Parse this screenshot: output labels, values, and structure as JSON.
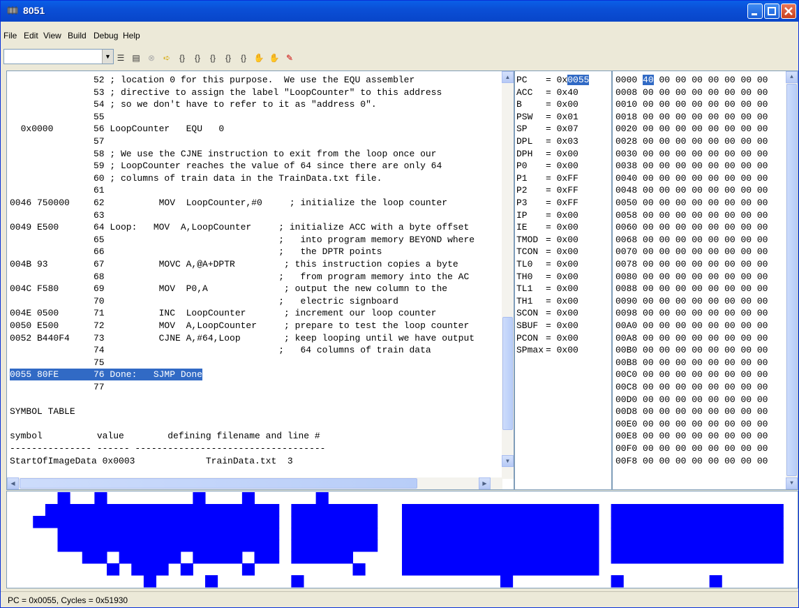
{
  "window": {
    "title": "8051"
  },
  "menu": [
    "File",
    "Edit",
    "View",
    "Build",
    "Debug",
    "Help"
  ],
  "toolbar": {
    "combo_value": "",
    "icons": [
      "list-icon",
      "step-icon",
      "stop-icon",
      "arrow-icon",
      "step-into-icon",
      "step-over-icon",
      "step-out-icon",
      "run-to-icon",
      "braces-icon",
      "hand-icon",
      "breakpoint-icon",
      "clear-icon"
    ]
  },
  "code": [
    {
      "addr": "",
      "src": "52 ; location 0 for this purpose.  We use the EQU assembler"
    },
    {
      "addr": "",
      "src": "53 ; directive to assign the label \"LoopCounter\" to this address"
    },
    {
      "addr": "",
      "src": "54 ; so we don't have to refer to it as \"address 0\"."
    },
    {
      "addr": "",
      "src": "55"
    },
    {
      "addr": "  0x0000",
      "src": "56 LoopCounter   EQU   0"
    },
    {
      "addr": "",
      "src": "57"
    },
    {
      "addr": "",
      "src": "58 ; We use the CJNE instruction to exit from the loop once our"
    },
    {
      "addr": "",
      "src": "59 ; LoopCounter reaches the value of 64 since there are only 64"
    },
    {
      "addr": "",
      "src": "60 ; columns of train data in the TrainData.txt file."
    },
    {
      "addr": "",
      "src": "61"
    },
    {
      "addr": "0046 750000",
      "src": "62          MOV  LoopCounter,#0     ; initialize the loop counter"
    },
    {
      "addr": "",
      "src": "63"
    },
    {
      "addr": "0049 E500",
      "src": "64 Loop:   MOV  A,LoopCounter     ; initialize ACC with a byte offset"
    },
    {
      "addr": "",
      "src": "65                                ;   into program memory BEYOND where"
    },
    {
      "addr": "",
      "src": "66                                ;   the DPTR points"
    },
    {
      "addr": "004B 93",
      "src": "67          MOVC A,@A+DPTR         ; this instruction copies a byte"
    },
    {
      "addr": "",
      "src": "68                                ;   from program memory into the AC"
    },
    {
      "addr": "004C F580",
      "src": "69          MOV  P0,A              ; output the new column to the"
    },
    {
      "addr": "",
      "src": "70                                ;   electric signboard"
    },
    {
      "addr": "004E 0500",
      "src": "71          INC  LoopCounter       ; increment our loop counter"
    },
    {
      "addr": "0050 E500",
      "src": "72          MOV  A,LoopCounter     ; prepare to test the loop counter"
    },
    {
      "addr": "0052 B440F4",
      "src": "73          CJNE A,#64,Loop        ; keep looping until we have output"
    },
    {
      "addr": "",
      "src": "74                                ;   64 columns of train data"
    },
    {
      "addr": "",
      "src": "75"
    },
    {
      "addr": "0055 80FE",
      "src": "76 Done:   SJMP Done",
      "highlight": true
    },
    {
      "addr": "",
      "src": "77"
    },
    {
      "addr": "",
      "src": ""
    },
    {
      "addr": "SYMBOL TABLE",
      "src": ""
    },
    {
      "addr": "",
      "src": ""
    },
    {
      "addr": "symbol          value        defining filename and line #",
      "src": ""
    },
    {
      "addr": "--------------- ------ -----------------------------------",
      "src": ""
    },
    {
      "addr": "StartOfImageData 0x0003             TrainData.txt  3",
      "src": ""
    }
  ],
  "registers": [
    {
      "name": "PC",
      "prefix": "= 0x",
      "value": "0055",
      "highlight": true
    },
    {
      "name": "ACC",
      "prefix": "= 0x",
      "value": "40"
    },
    {
      "name": "B",
      "prefix": "= 0x",
      "value": "00"
    },
    {
      "name": "PSW",
      "prefix": "= 0x",
      "value": "01"
    },
    {
      "name": "SP",
      "prefix": "= 0x",
      "value": "07"
    },
    {
      "name": "DPL",
      "prefix": "= 0x",
      "value": "03"
    },
    {
      "name": "DPH",
      "prefix": "= 0x",
      "value": "00"
    },
    {
      "name": "P0",
      "prefix": "= 0x",
      "value": "00"
    },
    {
      "name": "P1",
      "prefix": "= 0x",
      "value": "FF"
    },
    {
      "name": "P2",
      "prefix": "= 0x",
      "value": "FF"
    },
    {
      "name": "P3",
      "prefix": "= 0x",
      "value": "FF"
    },
    {
      "name": "IP",
      "prefix": "= 0x",
      "value": "00"
    },
    {
      "name": "IE",
      "prefix": "= 0x",
      "value": "00"
    },
    {
      "name": "TMOD",
      "prefix": "= 0x",
      "value": "00"
    },
    {
      "name": "TCON",
      "prefix": "= 0x",
      "value": "00"
    },
    {
      "name": "TL0",
      "prefix": "= 0x",
      "value": "00"
    },
    {
      "name": "TH0",
      "prefix": "= 0x",
      "value": "00"
    },
    {
      "name": "TL1",
      "prefix": "= 0x",
      "value": "00"
    },
    {
      "name": "TH1",
      "prefix": "= 0x",
      "value": "00"
    },
    {
      "name": "SCON",
      "prefix": "= 0x",
      "value": "00"
    },
    {
      "name": "SBUF",
      "prefix": "= 0x",
      "value": "00"
    },
    {
      "name": "PCON",
      "prefix": "= 0x",
      "value": "00"
    },
    {
      "name": "SPmax",
      "prefix": "= 0x",
      "value": "00"
    }
  ],
  "memory": [
    {
      "addr": "0000",
      "first": "40",
      "rest": "00 00 00 00 00 00 00",
      "highlight": true
    },
    {
      "addr": "0008",
      "first": "00",
      "rest": "00 00 00 00 00 00 00"
    },
    {
      "addr": "0010",
      "first": "00",
      "rest": "00 00 00 00 00 00 00"
    },
    {
      "addr": "0018",
      "first": "00",
      "rest": "00 00 00 00 00 00 00"
    },
    {
      "addr": "0020",
      "first": "00",
      "rest": "00 00 00 00 00 00 00"
    },
    {
      "addr": "0028",
      "first": "00",
      "rest": "00 00 00 00 00 00 00"
    },
    {
      "addr": "0030",
      "first": "00",
      "rest": "00 00 00 00 00 00 00"
    },
    {
      "addr": "0038",
      "first": "00",
      "rest": "00 00 00 00 00 00 00"
    },
    {
      "addr": "0040",
      "first": "00",
      "rest": "00 00 00 00 00 00 00"
    },
    {
      "addr": "0048",
      "first": "00",
      "rest": "00 00 00 00 00 00 00"
    },
    {
      "addr": "0050",
      "first": "00",
      "rest": "00 00 00 00 00 00 00"
    },
    {
      "addr": "0058",
      "first": "00",
      "rest": "00 00 00 00 00 00 00"
    },
    {
      "addr": "0060",
      "first": "00",
      "rest": "00 00 00 00 00 00 00"
    },
    {
      "addr": "0068",
      "first": "00",
      "rest": "00 00 00 00 00 00 00"
    },
    {
      "addr": "0070",
      "first": "00",
      "rest": "00 00 00 00 00 00 00"
    },
    {
      "addr": "0078",
      "first": "00",
      "rest": "00 00 00 00 00 00 00"
    },
    {
      "addr": "0080",
      "first": "00",
      "rest": "00 00 00 00 00 00 00"
    },
    {
      "addr": "0088",
      "first": "00",
      "rest": "00 00 00 00 00 00 00"
    },
    {
      "addr": "0090",
      "first": "00",
      "rest": "00 00 00 00 00 00 00"
    },
    {
      "addr": "0098",
      "first": "00",
      "rest": "00 00 00 00 00 00 00"
    },
    {
      "addr": "00A0",
      "first": "00",
      "rest": "00 00 00 00 00 00 00"
    },
    {
      "addr": "00A8",
      "first": "00",
      "rest": "00 00 00 00 00 00 00"
    },
    {
      "addr": "00B0",
      "first": "00",
      "rest": "00 00 00 00 00 00 00"
    },
    {
      "addr": "00B8",
      "first": "00",
      "rest": "00 00 00 00 00 00 00"
    },
    {
      "addr": "00C0",
      "first": "00",
      "rest": "00 00 00 00 00 00 00"
    },
    {
      "addr": "00C8",
      "first": "00",
      "rest": "00 00 00 00 00 00 00"
    },
    {
      "addr": "00D0",
      "first": "00",
      "rest": "00 00 00 00 00 00 00"
    },
    {
      "addr": "00D8",
      "first": "00",
      "rest": "00 00 00 00 00 00 00"
    },
    {
      "addr": "00E0",
      "first": "00",
      "rest": "00 00 00 00 00 00 00"
    },
    {
      "addr": "00E8",
      "first": "00",
      "rest": "00 00 00 00 00 00 00"
    },
    {
      "addr": "00F0",
      "first": "00",
      "rest": "00 00 00 00 00 00 00"
    },
    {
      "addr": "00F8",
      "first": "00",
      "rest": "00 00 00 00 00 00 00"
    }
  ],
  "signboard": {
    "pixel_color": "#0000ff",
    "columns": [
      "0x00",
      "0x00",
      "0x04",
      "0x06",
      "0x1F",
      "0x1E",
      "0x3E",
      "0x3F",
      "0x5E",
      "0x3E",
      "0x7E",
      "0xFE",
      "0x7E",
      "0x3E",
      "0x5E",
      "0x3F",
      "0xBE",
      "0x3E",
      "0x3E",
      "0x5F",
      "0x3E",
      "0x3E",
      "0x00",
      "0xBE",
      "0x3E",
      "0x3F",
      "0x3E",
      "0x3E",
      "0x5E",
      "0x1E",
      "0x00",
      "0x00",
      "0x7E",
      "0x7E",
      "0x7E",
      "0x7E",
      "0x7E",
      "0x7E",
      "0x7E",
      "0x7E",
      "0xFE",
      "0x7E",
      "0x7E",
      "0x7E",
      "0x7E",
      "0x7E",
      "0x7E",
      "0x7E",
      "0x00",
      "0xBE",
      "0x3E",
      "0x3E",
      "0x3E",
      "0x3E",
      "0x3E",
      "0x3E",
      "0x3E",
      "0xBE",
      "0x3E",
      "0x3E",
      "0x3E",
      "0x3E",
      "0x3E",
      "0x00"
    ]
  },
  "status": {
    "text": "PC = 0x0055, Cycles = 0x51930"
  }
}
